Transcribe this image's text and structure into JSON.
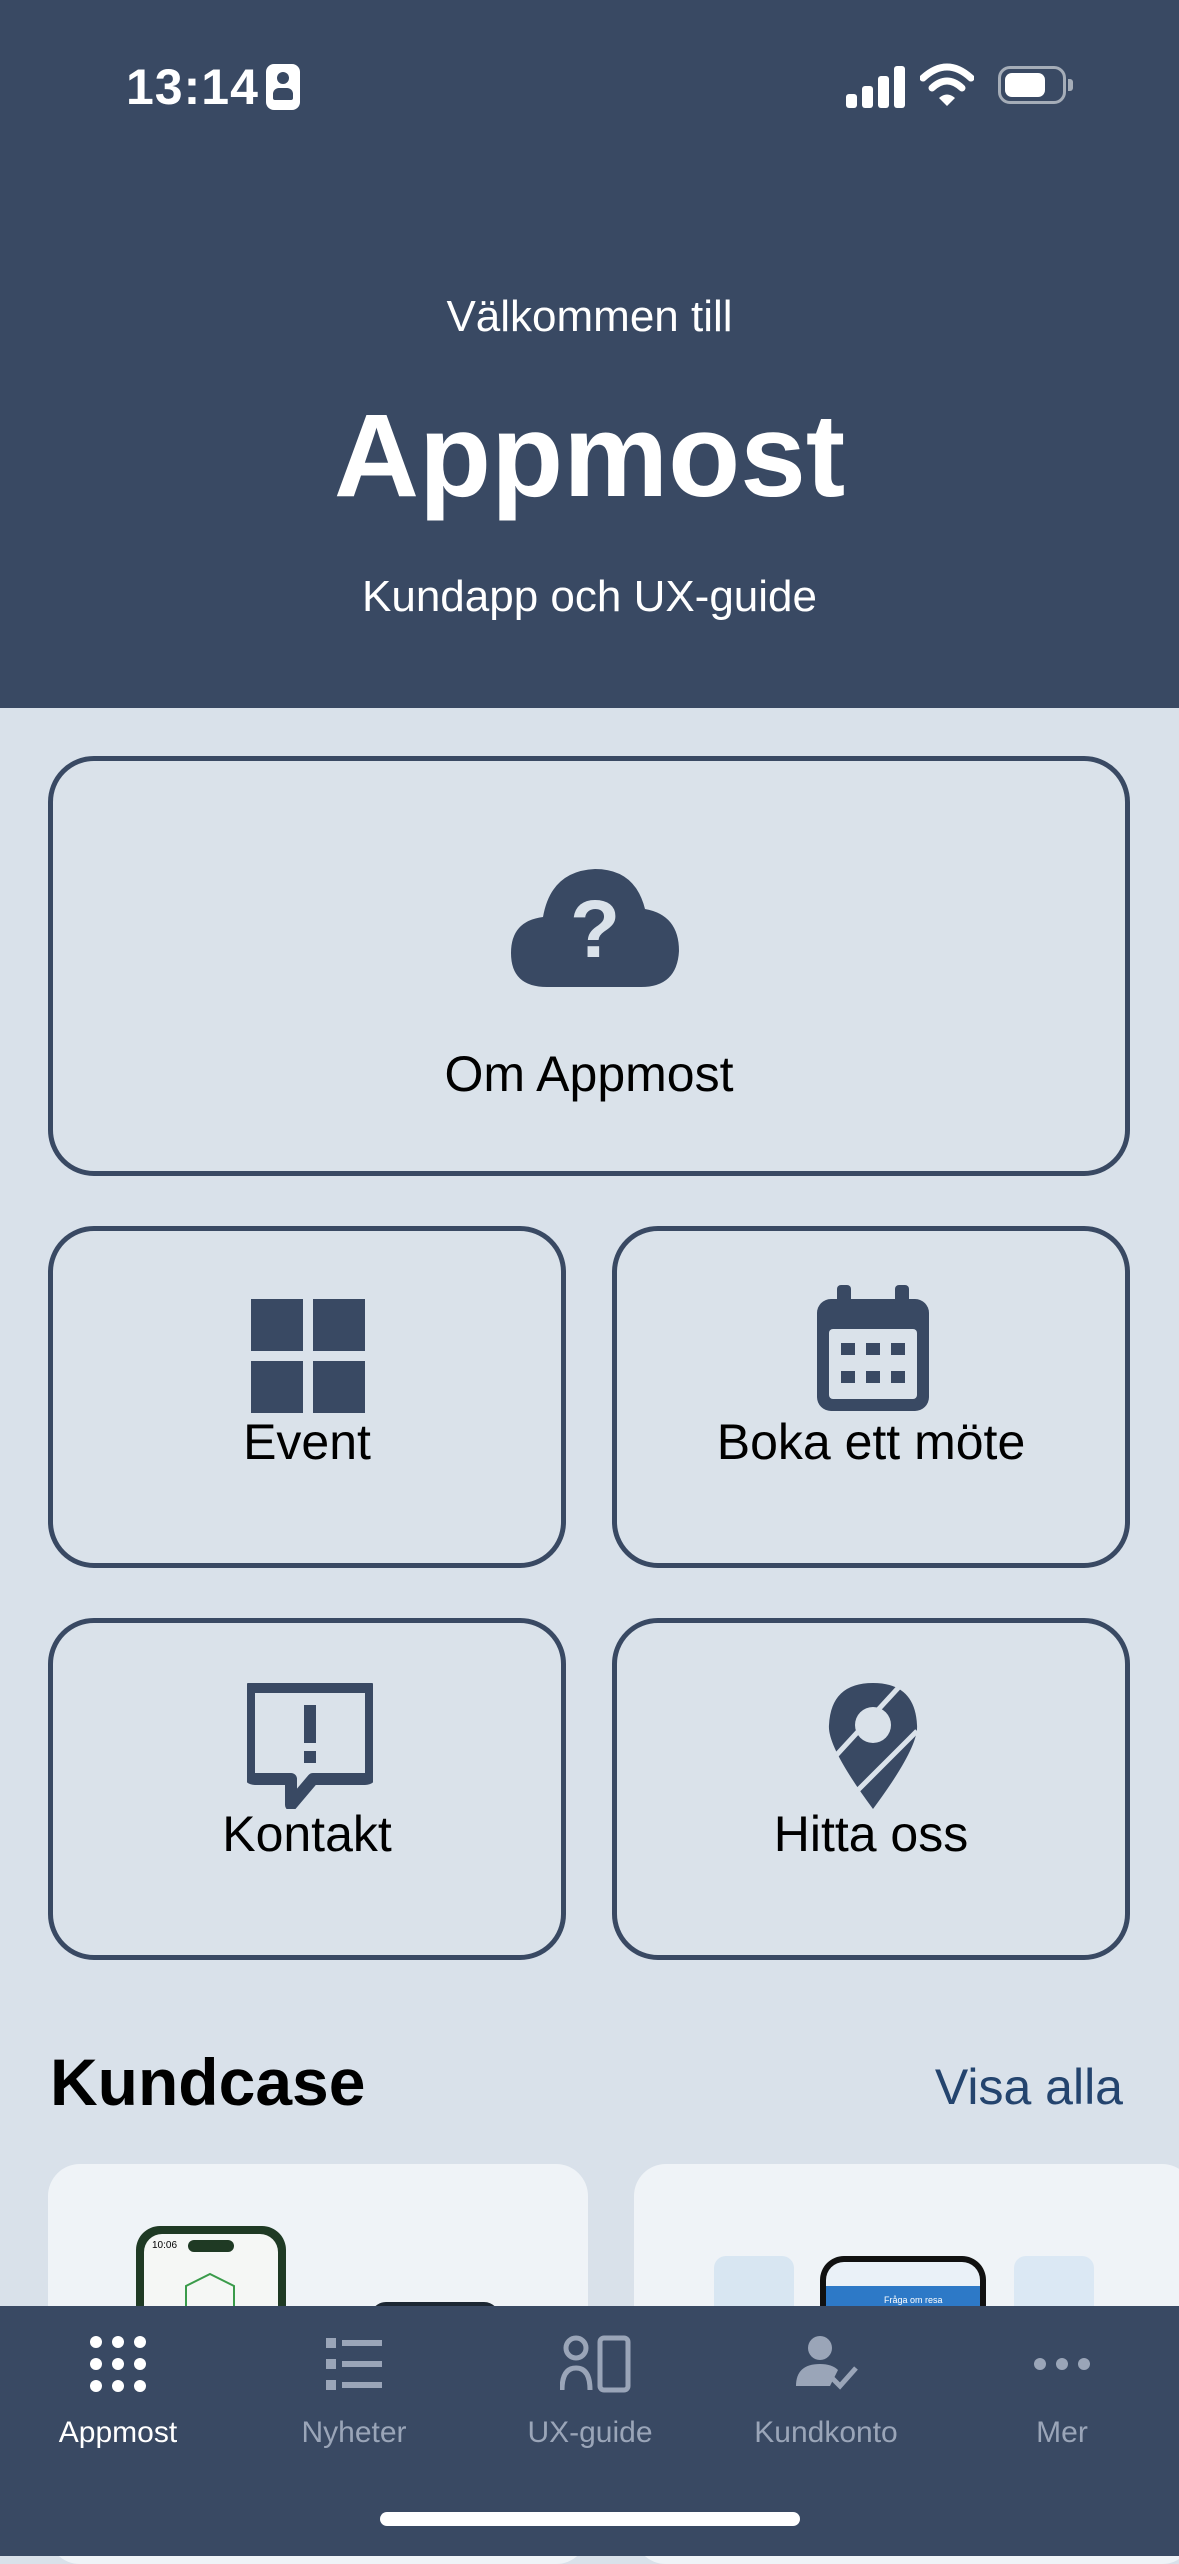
{
  "status_bar": {
    "time": "13:14"
  },
  "header": {
    "welcome": "Välkommen till",
    "title": "Appmost",
    "subtitle": "Kundapp och UX-guide"
  },
  "tiles": {
    "about": {
      "label": "Om Appmost",
      "icon": "cloud-question-icon"
    },
    "event": {
      "label": "Event",
      "icon": "grid-icon"
    },
    "booking": {
      "label": "Boka ett möte",
      "icon": "calendar-icon"
    },
    "contact": {
      "label": "Kontakt",
      "icon": "chat-exclamation-icon"
    },
    "find_us": {
      "label": "Hitta oss",
      "icon": "map-pin-icon"
    }
  },
  "kundcase": {
    "title": "Kundcase",
    "see_all": "Visa alla"
  },
  "tabbar": {
    "items": [
      {
        "label": "Appmost",
        "icon": "dots-grid-icon",
        "active": true
      },
      {
        "label": "Nyheter",
        "icon": "list-icon",
        "active": false
      },
      {
        "label": "UX-guide",
        "icon": "person-phone-icon",
        "active": false
      },
      {
        "label": "Kundkonto",
        "icon": "user-check-icon",
        "active": false
      },
      {
        "label": "Mer",
        "icon": "more-dots-icon",
        "active": false
      }
    ]
  },
  "colors": {
    "primary": "#394963",
    "background": "#d9e1ea",
    "link": "#24446e",
    "inactive_tab": "#9aa5b8"
  }
}
